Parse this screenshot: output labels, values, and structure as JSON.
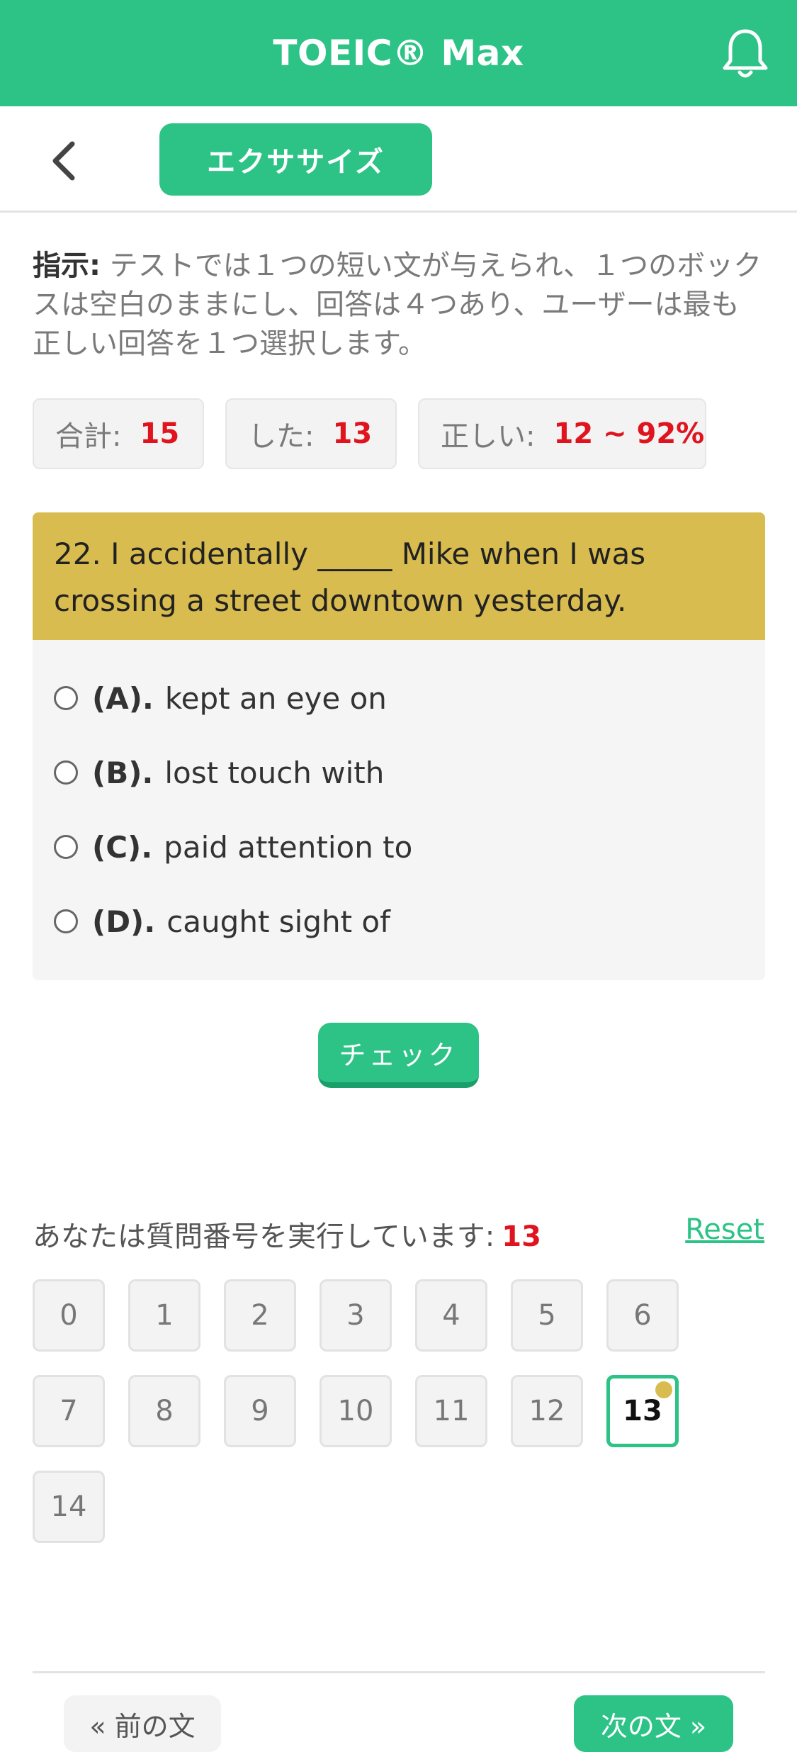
{
  "header": {
    "title": "TOEIC® Max"
  },
  "subnav": {
    "tab_label": "エクササイズ"
  },
  "instructions": {
    "label": "指示:",
    "text": "テストでは１つの短い文が与えられ、１つのボックスは空白のままにし、回答は４つあり、ユーザーは最も正しい回答を１つ選択します。"
  },
  "stats": {
    "total_label": "合計:",
    "total_value": "15",
    "done_label": "した:",
    "done_value": "13",
    "correct_label": "正しい:",
    "correct_value": "12 ~ 92%"
  },
  "question": {
    "text": "22. I accidentally _____ Mike when I was crossing a street downtown yesterday.",
    "options": [
      {
        "letter": "(A).",
        "text": "kept an eye on"
      },
      {
        "letter": "(B).",
        "text": "lost touch with"
      },
      {
        "letter": "(C).",
        "text": "paid attention to"
      },
      {
        "letter": "(D).",
        "text": "caught sight of"
      }
    ]
  },
  "check_label": "チェック",
  "progress": {
    "label": "あなたは質問番号を実行しています:",
    "current": "13",
    "reset_label": "Reset",
    "numbers": [
      "0",
      "1",
      "2",
      "3",
      "4",
      "5",
      "6",
      "7",
      "8",
      "9",
      "10",
      "11",
      "12",
      "13",
      "14"
    ]
  },
  "footer": {
    "prev_label": "« 前の文",
    "next_label": "次の文 »"
  },
  "colors": {
    "accent": "#2dc387",
    "question_bg": "#d9bc4f",
    "highlight": "#e0141e"
  }
}
